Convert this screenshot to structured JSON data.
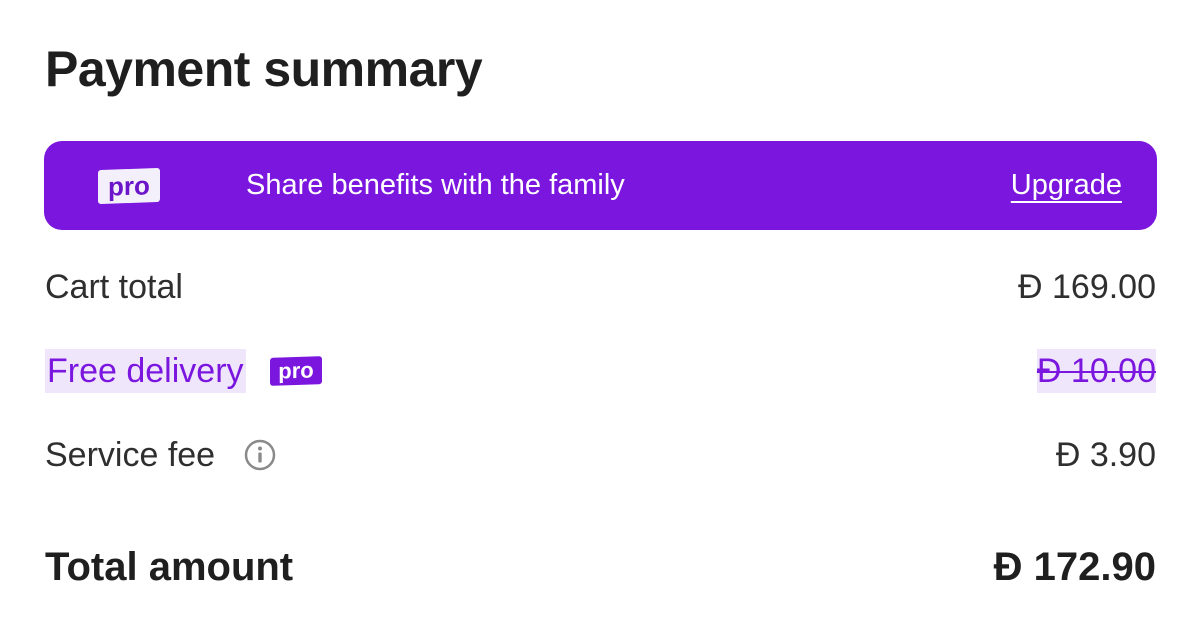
{
  "title": "Payment summary",
  "banner": {
    "badge": "pro",
    "text": "Share benefits with the family",
    "link": "Upgrade",
    "background_color": "#7b16df"
  },
  "rows": [
    {
      "label": "Cart total",
      "value": "Đ 169.00"
    },
    {
      "label": "Free delivery",
      "badge": "pro",
      "value": "Đ 10.00",
      "struck": true,
      "accent_color": "#7b16df"
    },
    {
      "label": "Service fee",
      "icon": "info-icon",
      "value": "Đ 3.90"
    }
  ],
  "total": {
    "label": "Total amount",
    "value": "Đ 172.90"
  }
}
